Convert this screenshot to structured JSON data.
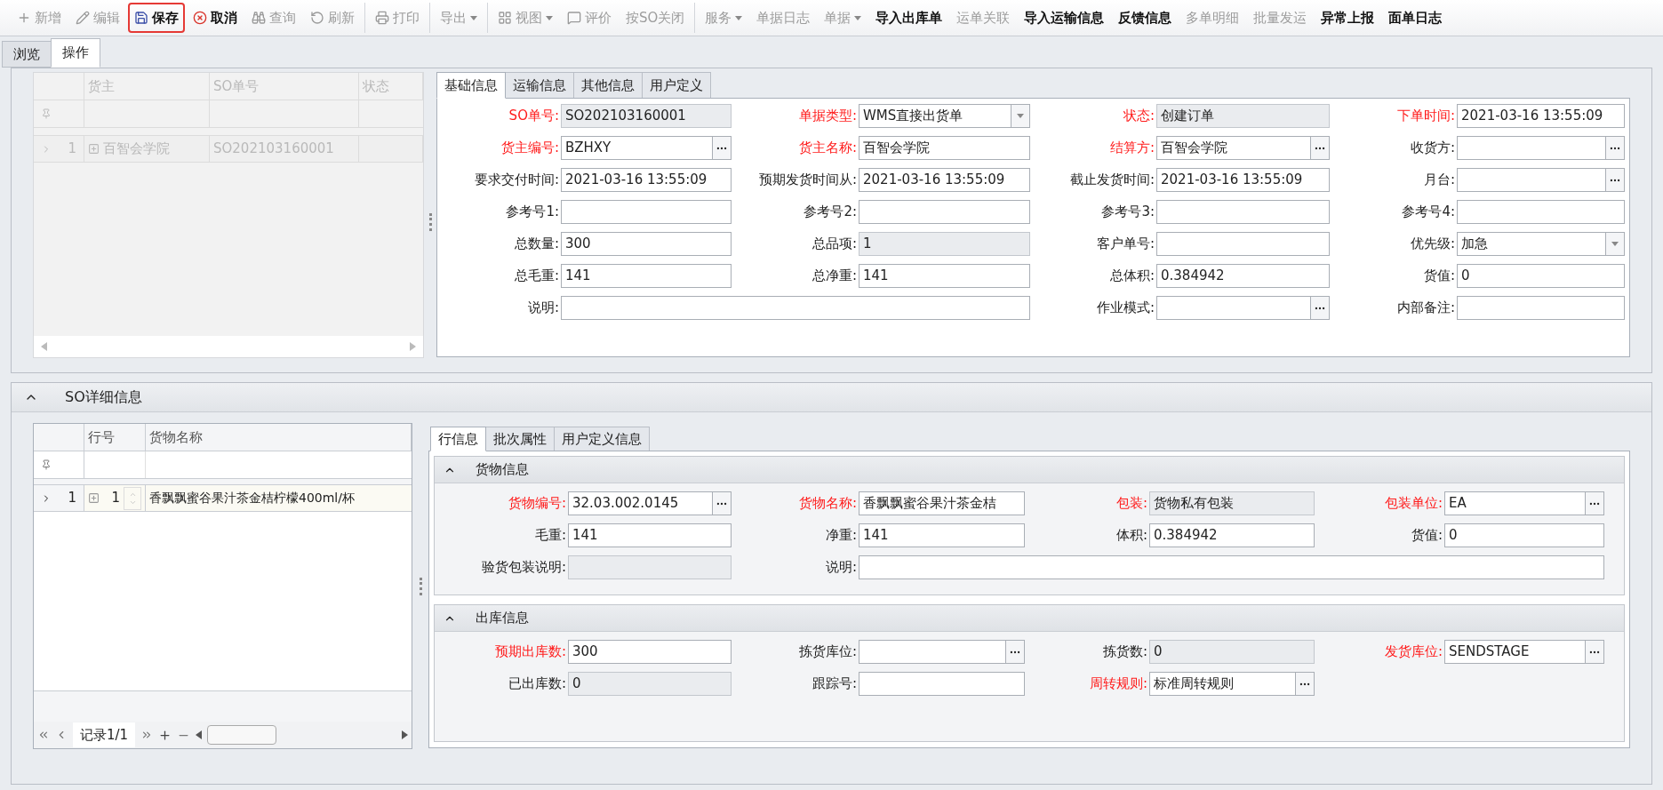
{
  "toolbar": {
    "groups": [
      [
        {
          "label": "新增",
          "kind": "plus",
          "disabled": true,
          "highlighted": false
        },
        {
          "label": "编辑",
          "kind": "pencil",
          "disabled": true,
          "highlighted": false
        },
        {
          "label": "保存",
          "kind": "save",
          "disabled": false,
          "highlighted": true
        },
        {
          "label": "取消",
          "kind": "cancel",
          "disabled": false,
          "highlighted": false
        },
        {
          "label": "查询",
          "kind": "binoculars",
          "disabled": true,
          "highlighted": false
        },
        {
          "label": "刷新",
          "kind": "refresh",
          "disabled": true,
          "highlighted": false
        }
      ],
      [
        {
          "label": "打印",
          "kind": "print",
          "disabled": true,
          "highlighted": false
        }
      ],
      [
        {
          "label": "导出",
          "dropdown": true,
          "disabled": true,
          "highlighted": false
        }
      ],
      [
        {
          "label": "视图",
          "kind": "grid",
          "dropdown": true,
          "disabled": true,
          "highlighted": false
        },
        {
          "label": "评价",
          "kind": "comment",
          "disabled": true,
          "highlighted": false
        },
        {
          "label": "按SO关闭",
          "disabled": true,
          "highlighted": false
        }
      ],
      [
        {
          "label": "服务",
          "dropdown": true,
          "disabled": true,
          "highlighted": false
        },
        {
          "label": "单据日志",
          "disabled": true,
          "highlighted": false
        },
        {
          "label": "单据",
          "dropdown": true,
          "disabled": true,
          "highlighted": false
        },
        {
          "label": "导入出库单",
          "disabled": false,
          "highlighted": false
        },
        {
          "label": "运单关联",
          "disabled": true,
          "highlighted": false
        },
        {
          "label": "导入运输信息",
          "disabled": false,
          "highlighted": false
        },
        {
          "label": "反馈信息",
          "disabled": false,
          "highlighted": false
        },
        {
          "label": "多单明细",
          "disabled": true,
          "highlighted": false
        },
        {
          "label": "批量发运",
          "disabled": true,
          "highlighted": false
        },
        {
          "label": "异常上报",
          "disabled": false,
          "highlighted": false
        },
        {
          "label": "面单日志",
          "disabled": false,
          "highlighted": false
        }
      ]
    ]
  },
  "main_tabs": [
    {
      "label": "浏览",
      "selected": false
    },
    {
      "label": "操作",
      "selected": true
    }
  ],
  "order_grid": {
    "columns": [
      "货主",
      "SO单号",
      "状态"
    ],
    "rows": [
      {
        "row_number": "1",
        "cells": [
          "百智会学院",
          "SO202103160001",
          ""
        ]
      }
    ]
  },
  "order_tabs": [
    {
      "label": "基础信息",
      "selected": true
    },
    {
      "label": "运输信息",
      "selected": false
    },
    {
      "label": "其他信息",
      "selected": false
    },
    {
      "label": "用户定义",
      "selected": false
    }
  ],
  "order_form": [
    [
      {
        "label": "SO单号:",
        "value": "SO202103160001",
        "kind": "readonly",
        "required": true
      },
      {
        "label": "单据类型:",
        "value": "WMS直接出货单",
        "kind": "dropdown",
        "required": true
      },
      {
        "label": "状态:",
        "value": "创建订单",
        "kind": "readonly",
        "required": true
      },
      {
        "label": "下单时间:",
        "value": "2021-03-16 13:55:09",
        "kind": "text",
        "required": true
      }
    ],
    [
      {
        "label": "货主编号:",
        "value": "BZHXY",
        "kind": "lookup",
        "required": true
      },
      {
        "label": "货主名称:",
        "value": "百智会学院",
        "kind": "text",
        "required": true
      },
      {
        "label": "结算方:",
        "value": "百智会学院",
        "kind": "lookup",
        "required": true
      },
      {
        "label": "收货方:",
        "kind": "lookup",
        "required": false
      }
    ],
    [
      {
        "label": "要求交付时间:",
        "value": "2021-03-16 13:55:09",
        "kind": "text",
        "required": false
      },
      {
        "label": "预期发货时间从:",
        "value": "2021-03-16 13:55:09",
        "kind": "text",
        "required": false
      },
      {
        "label": "截止发货时间:",
        "value": "2021-03-16 13:55:09",
        "kind": "text",
        "required": false
      },
      {
        "label": "月台:",
        "kind": "lookup",
        "required": false
      }
    ],
    [
      {
        "label": "参考号1:",
        "kind": "text",
        "required": false
      },
      {
        "label": "参考号2:",
        "kind": "text",
        "required": false
      },
      {
        "label": "参考号3:",
        "kind": "text",
        "required": false
      },
      {
        "label": "参考号4:",
        "kind": "text",
        "required": false
      }
    ],
    [
      {
        "label": "总数量:",
        "value": "300",
        "kind": "text",
        "required": false
      },
      {
        "label": "总品项:",
        "value": "1",
        "kind": "readonly",
        "required": false
      },
      {
        "label": "客户单号:",
        "kind": "text",
        "required": false
      },
      {
        "label": "优先级:",
        "value": "加急",
        "kind": "dropdown",
        "required": false
      }
    ],
    [
      {
        "label": "总毛重:",
        "value": "141",
        "kind": "text",
        "required": false
      },
      {
        "label": "总净重:",
        "value": "141",
        "kind": "text",
        "required": false
      },
      {
        "label": "总体积:",
        "value": "0.384942",
        "kind": "text",
        "required": false
      },
      {
        "label": "货值:",
        "value": "0",
        "kind": "text",
        "required": false
      }
    ],
    [
      {
        "label": "说明:",
        "kind": "text",
        "required": false,
        "wide": true
      },
      {
        "label": "作业模式:",
        "kind": "lookup",
        "required": false
      },
      {
        "label": "内部备注:",
        "kind": "text",
        "required": false
      }
    ]
  ],
  "detail_section": {
    "title": "SO详细信息",
    "expanded": true
  },
  "line_grid": {
    "columns": [
      "行号",
      "货物名称"
    ],
    "rows": [
      {
        "row_number": "1",
        "line_no": "1",
        "name": "香飘飘蜜谷果汁茶金桔柠檬400ml/杯"
      }
    ],
    "record": "记录1/1"
  },
  "line_tabs": [
    {
      "label": "行信息",
      "selected": true
    },
    {
      "label": "批次属性",
      "selected": false
    },
    {
      "label": "用户定义信息",
      "selected": false
    }
  ],
  "line_groups": [
    {
      "title": "货物信息",
      "expanded": true,
      "rows": [
        [
          {
            "label": "货物编号:",
            "value": "32.03.002.0145",
            "kind": "lookup",
            "required": true
          },
          {
            "label": "货物名称:",
            "value": "香飘飘蜜谷果汁茶金桔",
            "kind": "text",
            "required": true
          },
          {
            "label": "包装:",
            "value": "货物私有包装",
            "kind": "readonly",
            "required": true
          },
          {
            "label": "包装单位:",
            "value": "EA",
            "kind": "lookup",
            "required": true
          }
        ],
        [
          {
            "label": "毛重:",
            "value": "141",
            "kind": "text",
            "required": false
          },
          {
            "label": "净重:",
            "value": "141",
            "kind": "text",
            "required": false
          },
          {
            "label": "体积:",
            "value": "0.384942",
            "kind": "text",
            "required": false
          },
          {
            "label": "货值:",
            "value": "0",
            "kind": "text",
            "required": false
          }
        ],
        [
          {
            "label": "验货包装说明:",
            "kind": "readonly",
            "required": false
          },
          {
            "label": "说明:",
            "kind": "text",
            "required": false,
            "wide": true
          }
        ]
      ]
    },
    {
      "title": "出库信息",
      "expanded": true,
      "rows": [
        [
          {
            "label": "预期出库数:",
            "value": "300",
            "kind": "text",
            "required": true
          },
          {
            "label": "拣货库位:",
            "kind": "lookup",
            "required": false
          },
          {
            "label": "拣货数:",
            "value": "0",
            "kind": "readonly",
            "required": false
          },
          {
            "label": "发货库位:",
            "value": "SENDSTAGE",
            "kind": "lookup",
            "required": true
          }
        ],
        [
          {
            "label": "已出库数:",
            "value": "0",
            "kind": "readonly",
            "required": false
          },
          {
            "label": "跟踪号:",
            "kind": "text",
            "required": false
          },
          {
            "label": "周转规则:",
            "value": "标准周转规则",
            "kind": "lookup",
            "required": true
          }
        ]
      ]
    }
  ]
}
